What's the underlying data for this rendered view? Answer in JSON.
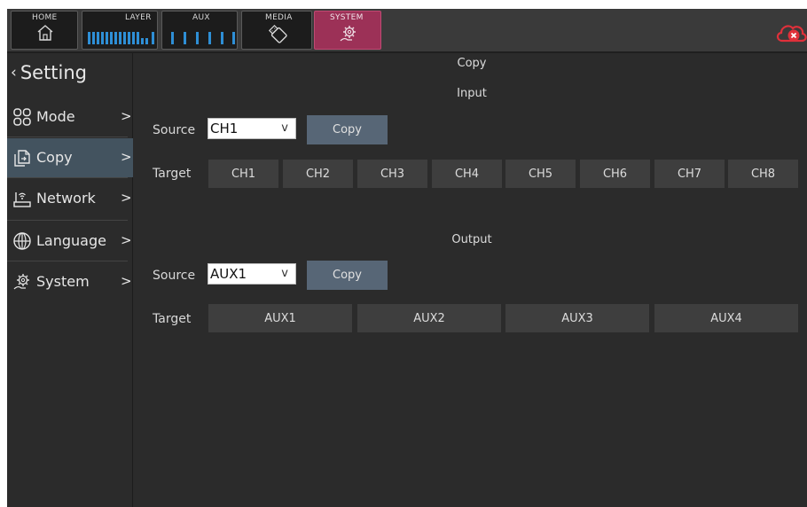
{
  "topbar": {
    "tabs": [
      {
        "label": "HOME",
        "icon": "home-icon"
      },
      {
        "label": "LAYER",
        "icon": "layer-channels-icon"
      },
      {
        "label": "AUX",
        "icon": "aux-channels-icon"
      },
      {
        "label": "MEDIA",
        "icon": "usb-drive-icon"
      },
      {
        "label": "SYSTEM",
        "icon": "gear-hand-icon",
        "selected": true
      }
    ],
    "status_icon": "cloud-disconnected-icon"
  },
  "sidebar": {
    "back_label": "Setting",
    "items": [
      {
        "label": "Mode",
        "icon": "mode-grid-icon",
        "active": false
      },
      {
        "label": "Copy",
        "icon": "copy-document-icon",
        "active": true
      },
      {
        "label": "Network",
        "icon": "router-icon",
        "active": false
      },
      {
        "label": "Language",
        "icon": "globe-icon",
        "active": false
      },
      {
        "label": "System",
        "icon": "gear-hand-icon",
        "active": false
      }
    ]
  },
  "main": {
    "title": "Copy",
    "input": {
      "heading": "Input",
      "source_label": "Source",
      "source_value": "CH1",
      "dropdown_arrow": "v",
      "copy_label": "Copy",
      "target_label": "Target",
      "targets": [
        "CH1",
        "CH2",
        "CH3",
        "CH4",
        "CH5",
        "CH6",
        "CH7",
        "CH8"
      ]
    },
    "output": {
      "heading": "Output",
      "source_label": "Source",
      "source_value": "AUX1",
      "dropdown_arrow": "v",
      "copy_label": "Copy",
      "target_label": "Target",
      "targets": [
        "AUX1",
        "AUX2",
        "AUX3",
        "AUX4"
      ]
    }
  },
  "colors": {
    "selected_tab": "#9c3157",
    "active_nav": "#43535f",
    "copy_button": "#576676",
    "channel_meter": "#2e8fd6",
    "alert": "#e0303a"
  }
}
